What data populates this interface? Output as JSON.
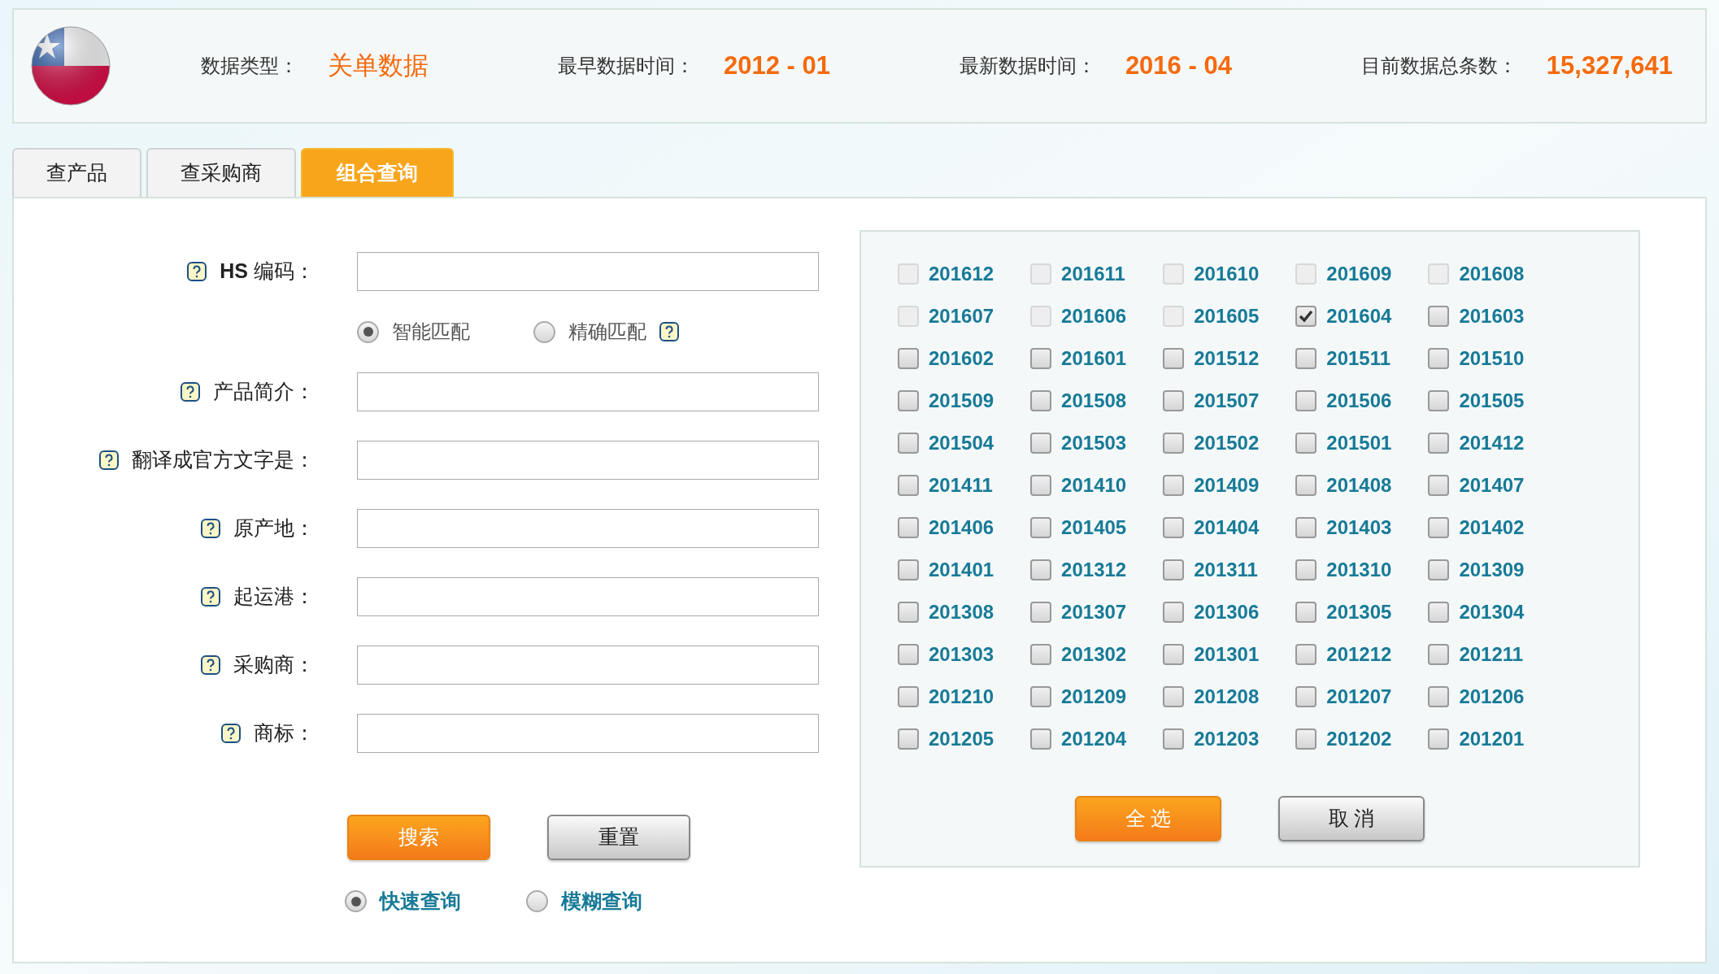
{
  "header": {
    "stats": [
      {
        "label": "数据类型：",
        "value": "关单数据",
        "kind": "text"
      },
      {
        "label": "最早数据时间：",
        "value": "2012 - 01",
        "kind": "number"
      },
      {
        "label": "最新数据时间：",
        "value": "2016 - 04",
        "kind": "number"
      },
      {
        "label": "目前数据总条数：",
        "value": "15,327,641",
        "kind": "number"
      }
    ]
  },
  "tabs": [
    {
      "label": "查产品",
      "selected": false
    },
    {
      "label": "查采购商",
      "selected": false
    },
    {
      "label": "组合查询",
      "selected": true
    }
  ],
  "form": {
    "rows": [
      {
        "kind": "text",
        "label": "**HS** 编码："
      },
      {
        "kind": "radio",
        "options": [
          {
            "label": "智能匹配",
            "selected": true
          },
          {
            "label": "精确匹配",
            "selected": false
          }
        ]
      },
      {
        "kind": "text",
        "label": "产品简介："
      },
      {
        "kind": "text",
        "label": "翻译成官方文字是："
      },
      {
        "kind": "text",
        "label": "原产地："
      },
      {
        "kind": "text",
        "label": "起运港："
      },
      {
        "kind": "text",
        "label": "采购商："
      },
      {
        "kind": "text",
        "label": "商标："
      }
    ],
    "buttons": [
      {
        "label": "搜索",
        "kind": "primary"
      },
      {
        "label": "重置",
        "kind": "secondary"
      }
    ],
    "search_mode": [
      {
        "label": "快速查询",
        "selected": true
      },
      {
        "label": "模糊查询",
        "selected": false
      }
    ]
  },
  "months": {
    "items": [
      {
        "label": "201612",
        "checked": false,
        "disabled": true
      },
      {
        "label": "201611",
        "checked": false,
        "disabled": true
      },
      {
        "label": "201610",
        "checked": false,
        "disabled": true
      },
      {
        "label": "201609",
        "checked": false,
        "disabled": true
      },
      {
        "label": "201608",
        "checked": false,
        "disabled": true
      },
      {
        "label": "201607",
        "checked": false,
        "disabled": true
      },
      {
        "label": "201606",
        "checked": false,
        "disabled": true
      },
      {
        "label": "201605",
        "checked": false,
        "disabled": true
      },
      {
        "label": "201604",
        "checked": true,
        "disabled": false
      },
      {
        "label": "201603",
        "checked": false,
        "disabled": false
      },
      {
        "label": "201602",
        "checked": false,
        "disabled": false
      },
      {
        "label": "201601",
        "checked": false,
        "disabled": false
      },
      {
        "label": "201512",
        "checked": false,
        "disabled": false
      },
      {
        "label": "201511",
        "checked": false,
        "disabled": false
      },
      {
        "label": "201510",
        "checked": false,
        "disabled": false
      },
      {
        "label": "201509",
        "checked": false,
        "disabled": false
      },
      {
        "label": "201508",
        "checked": false,
        "disabled": false
      },
      {
        "label": "201507",
        "checked": false,
        "disabled": false
      },
      {
        "label": "201506",
        "checked": false,
        "disabled": false
      },
      {
        "label": "201505",
        "checked": false,
        "disabled": false
      },
      {
        "label": "201504",
        "checked": false,
        "disabled": false
      },
      {
        "label": "201503",
        "checked": false,
        "disabled": false
      },
      {
        "label": "201502",
        "checked": false,
        "disabled": false
      },
      {
        "label": "201501",
        "checked": false,
        "disabled": false
      },
      {
        "label": "201412",
        "checked": false,
        "disabled": false
      },
      {
        "label": "201411",
        "checked": false,
        "disabled": false
      },
      {
        "label": "201410",
        "checked": false,
        "disabled": false
      },
      {
        "label": "201409",
        "checked": false,
        "disabled": false
      },
      {
        "label": "201408",
        "checked": false,
        "disabled": false
      },
      {
        "label": "201407",
        "checked": false,
        "disabled": false
      },
      {
        "label": "201406",
        "checked": false,
        "disabled": false
      },
      {
        "label": "201405",
        "checked": false,
        "disabled": false
      },
      {
        "label": "201404",
        "checked": false,
        "disabled": false
      },
      {
        "label": "201403",
        "checked": false,
        "disabled": false
      },
      {
        "label": "201402",
        "checked": false,
        "disabled": false
      },
      {
        "label": "201401",
        "checked": false,
        "disabled": false
      },
      {
        "label": "201312",
        "checked": false,
        "disabled": false
      },
      {
        "label": "201311",
        "checked": false,
        "disabled": false
      },
      {
        "label": "201310",
        "checked": false,
        "disabled": false
      },
      {
        "label": "201309",
        "checked": false,
        "disabled": false
      },
      {
        "label": "201308",
        "checked": false,
        "disabled": false
      },
      {
        "label": "201307",
        "checked": false,
        "disabled": false
      },
      {
        "label": "201306",
        "checked": false,
        "disabled": false
      },
      {
        "label": "201305",
        "checked": false,
        "disabled": false
      },
      {
        "label": "201304",
        "checked": false,
        "disabled": false
      },
      {
        "label": "201303",
        "checked": false,
        "disabled": false
      },
      {
        "label": "201302",
        "checked": false,
        "disabled": false
      },
      {
        "label": "201301",
        "checked": false,
        "disabled": false
      },
      {
        "label": "201212",
        "checked": false,
        "disabled": false
      },
      {
        "label": "201211",
        "checked": false,
        "disabled": false
      },
      {
        "label": "201210",
        "checked": false,
        "disabled": false
      },
      {
        "label": "201209",
        "checked": false,
        "disabled": false
      },
      {
        "label": "201208",
        "checked": false,
        "disabled": false
      },
      {
        "label": "201207",
        "checked": false,
        "disabled": false
      },
      {
        "label": "201206",
        "checked": false,
        "disabled": false
      },
      {
        "label": "201205",
        "checked": false,
        "disabled": false
      },
      {
        "label": "201204",
        "checked": false,
        "disabled": false
      },
      {
        "label": "201203",
        "checked": false,
        "disabled": false
      },
      {
        "label": "201202",
        "checked": false,
        "disabled": false
      },
      {
        "label": "201201",
        "checked": false,
        "disabled": false
      }
    ],
    "buttons": [
      {
        "label": "全 选",
        "kind": "primary"
      },
      {
        "label": "取 消",
        "kind": "secondary"
      }
    ]
  }
}
